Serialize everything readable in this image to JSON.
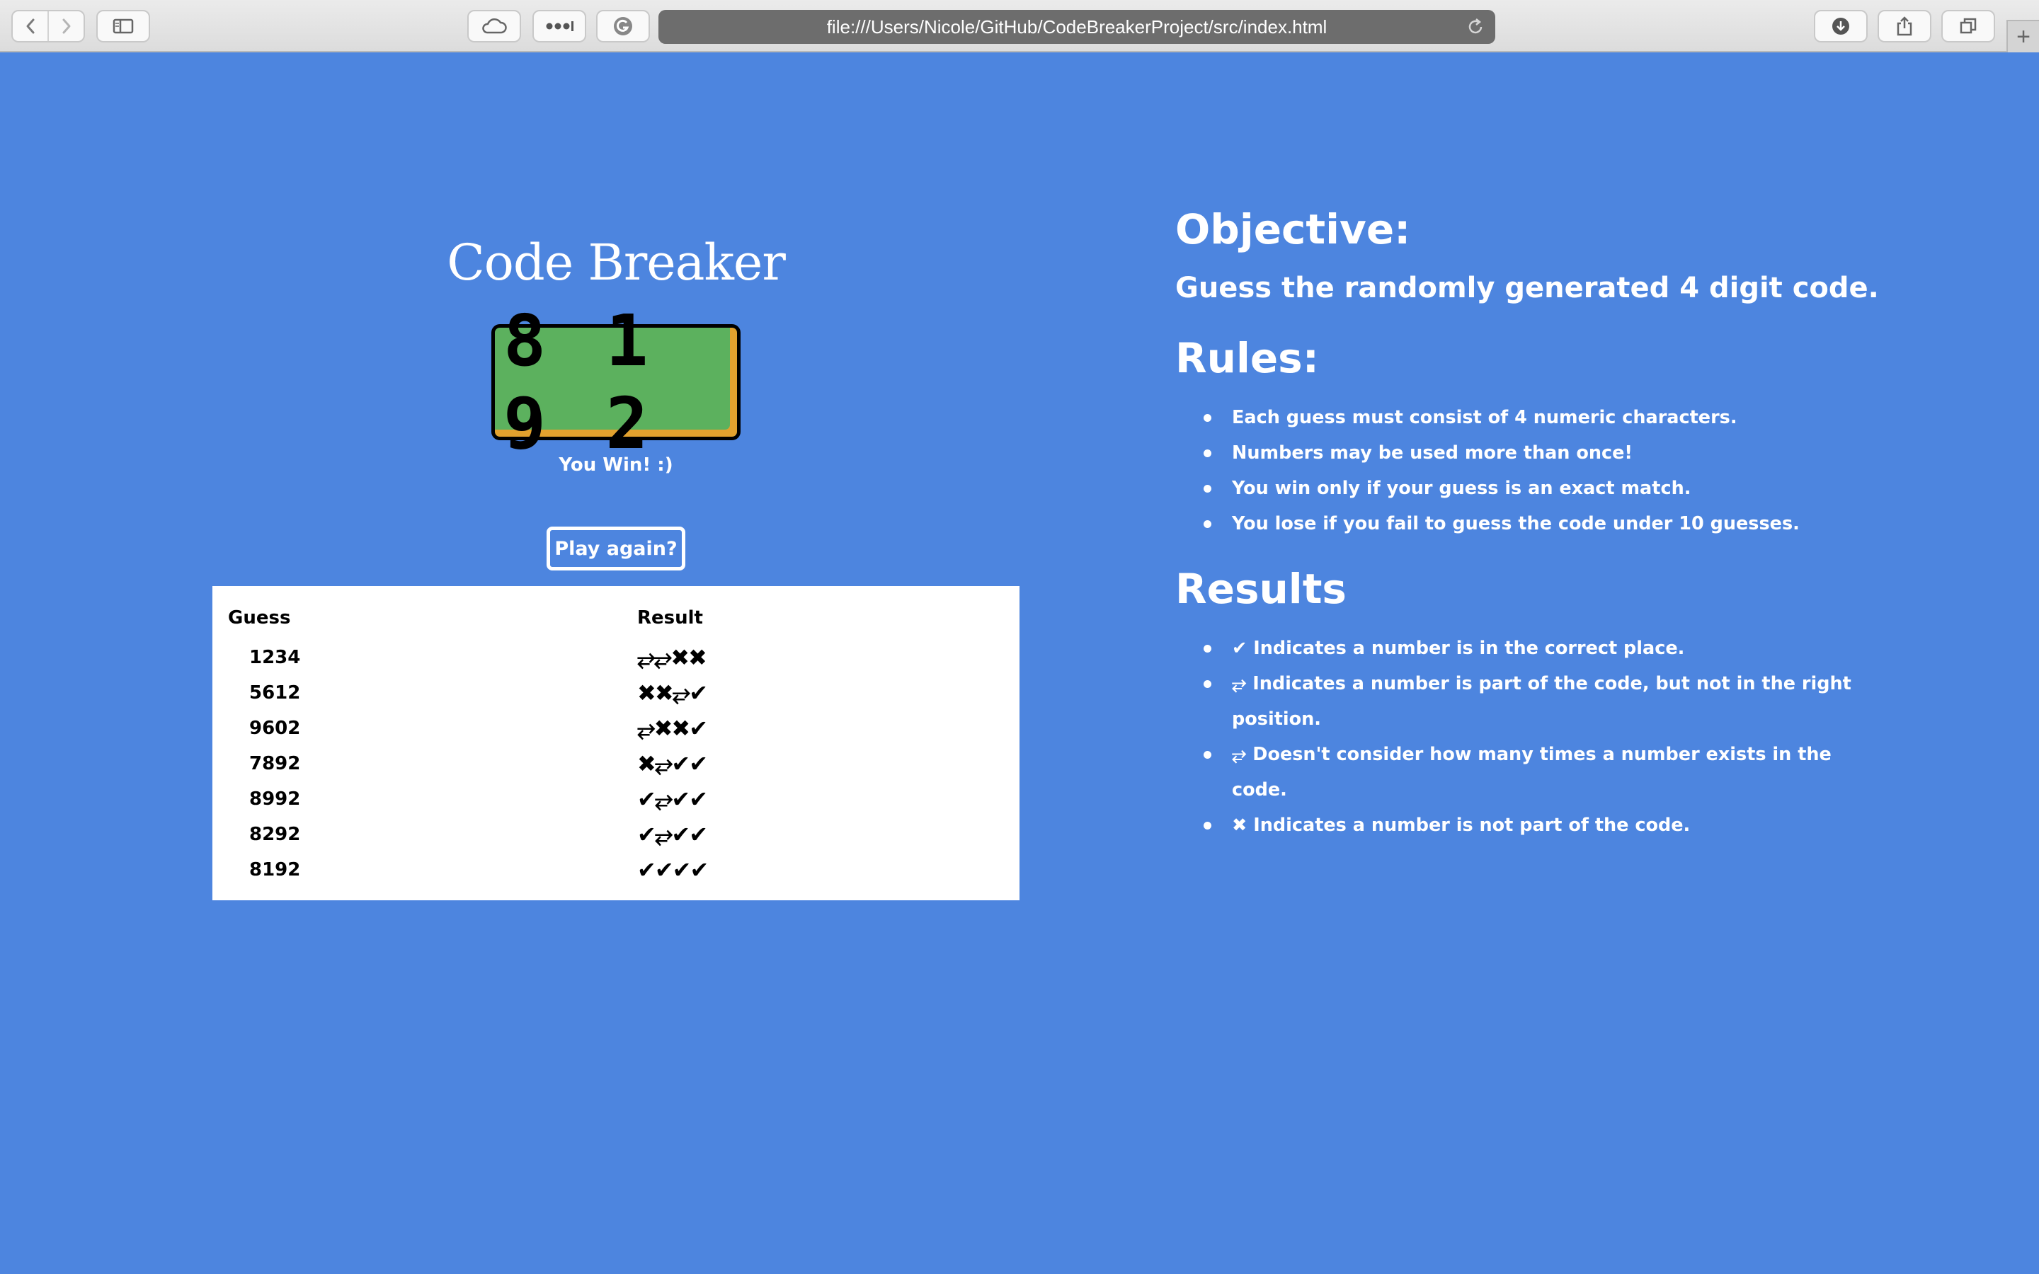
{
  "browser": {
    "url": "file:///Users/Nicole/GitHub/CodeBreakerProject/src/index.html",
    "new_tab_label": "+"
  },
  "game": {
    "title": "Code Breaker",
    "code_digits": "8 1 9 2",
    "status": "You Win! :)",
    "play_again_label": "Play again?",
    "table": {
      "headers": {
        "guess": "Guess",
        "result": "Result"
      },
      "rows": [
        {
          "guess": "1234",
          "result": "⥂⥂✖✖"
        },
        {
          "guess": "5612",
          "result": "✖✖⥂✔"
        },
        {
          "guess": "9602",
          "result": "⥂✖✖✔"
        },
        {
          "guess": "7892",
          "result": "✖⥂✔✔"
        },
        {
          "guess": "8992",
          "result": "✔⥂✔✔"
        },
        {
          "guess": "8292",
          "result": "✔⥂✔✔"
        },
        {
          "guess": "8192",
          "result": "✔✔✔✔"
        }
      ]
    }
  },
  "info": {
    "objective_heading": "Objective:",
    "objective_text": "Guess the randomly generated 4 digit code.",
    "rules_heading": "Rules:",
    "rules": [
      "Each guess must consist of 4 numeric characters.",
      "Numbers may be used more than once!",
      "You win only if your guess is an exact match.",
      "You lose if you fail to guess the code under 10 guesses."
    ],
    "results_heading": "Results",
    "legend": [
      "✔ Indicates a number is in the correct place.",
      "⥂ Indicates a number is part of the code, but not in the right position.",
      "⥂ Doesn't consider how many times a number exists in the code.",
      "✖ Indicates a number is not part of the code."
    ]
  },
  "colors": {
    "page_bg": "#4d85df",
    "code_bg": "#5cb15e",
    "code_accent": "#e2a12e"
  }
}
